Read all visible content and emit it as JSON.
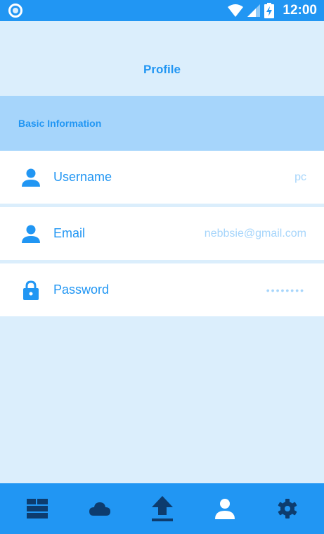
{
  "status_bar": {
    "time": "12:00"
  },
  "header": {
    "title": "Profile"
  },
  "section": {
    "title": "Basic Information"
  },
  "fields": [
    {
      "label": "Username",
      "value": "pc",
      "icon": "person-icon"
    },
    {
      "label": "Email",
      "value": "nebbsie@gmail.com",
      "icon": "person-icon"
    },
    {
      "label": "Password",
      "value": "••••••••",
      "icon": "lock-icon"
    }
  ],
  "bottom_nav": [
    {
      "icon": "dashboard-icon"
    },
    {
      "icon": "cloud-icon"
    },
    {
      "icon": "upload-icon"
    },
    {
      "icon": "person-icon",
      "active": true
    },
    {
      "icon": "gear-icon"
    }
  ],
  "colors": {
    "primary": "#2196f3",
    "background": "#dbeefc",
    "section": "#a6d5fb",
    "value_text": "#a6d5fb",
    "nav_icon": "#0d3c6e"
  }
}
